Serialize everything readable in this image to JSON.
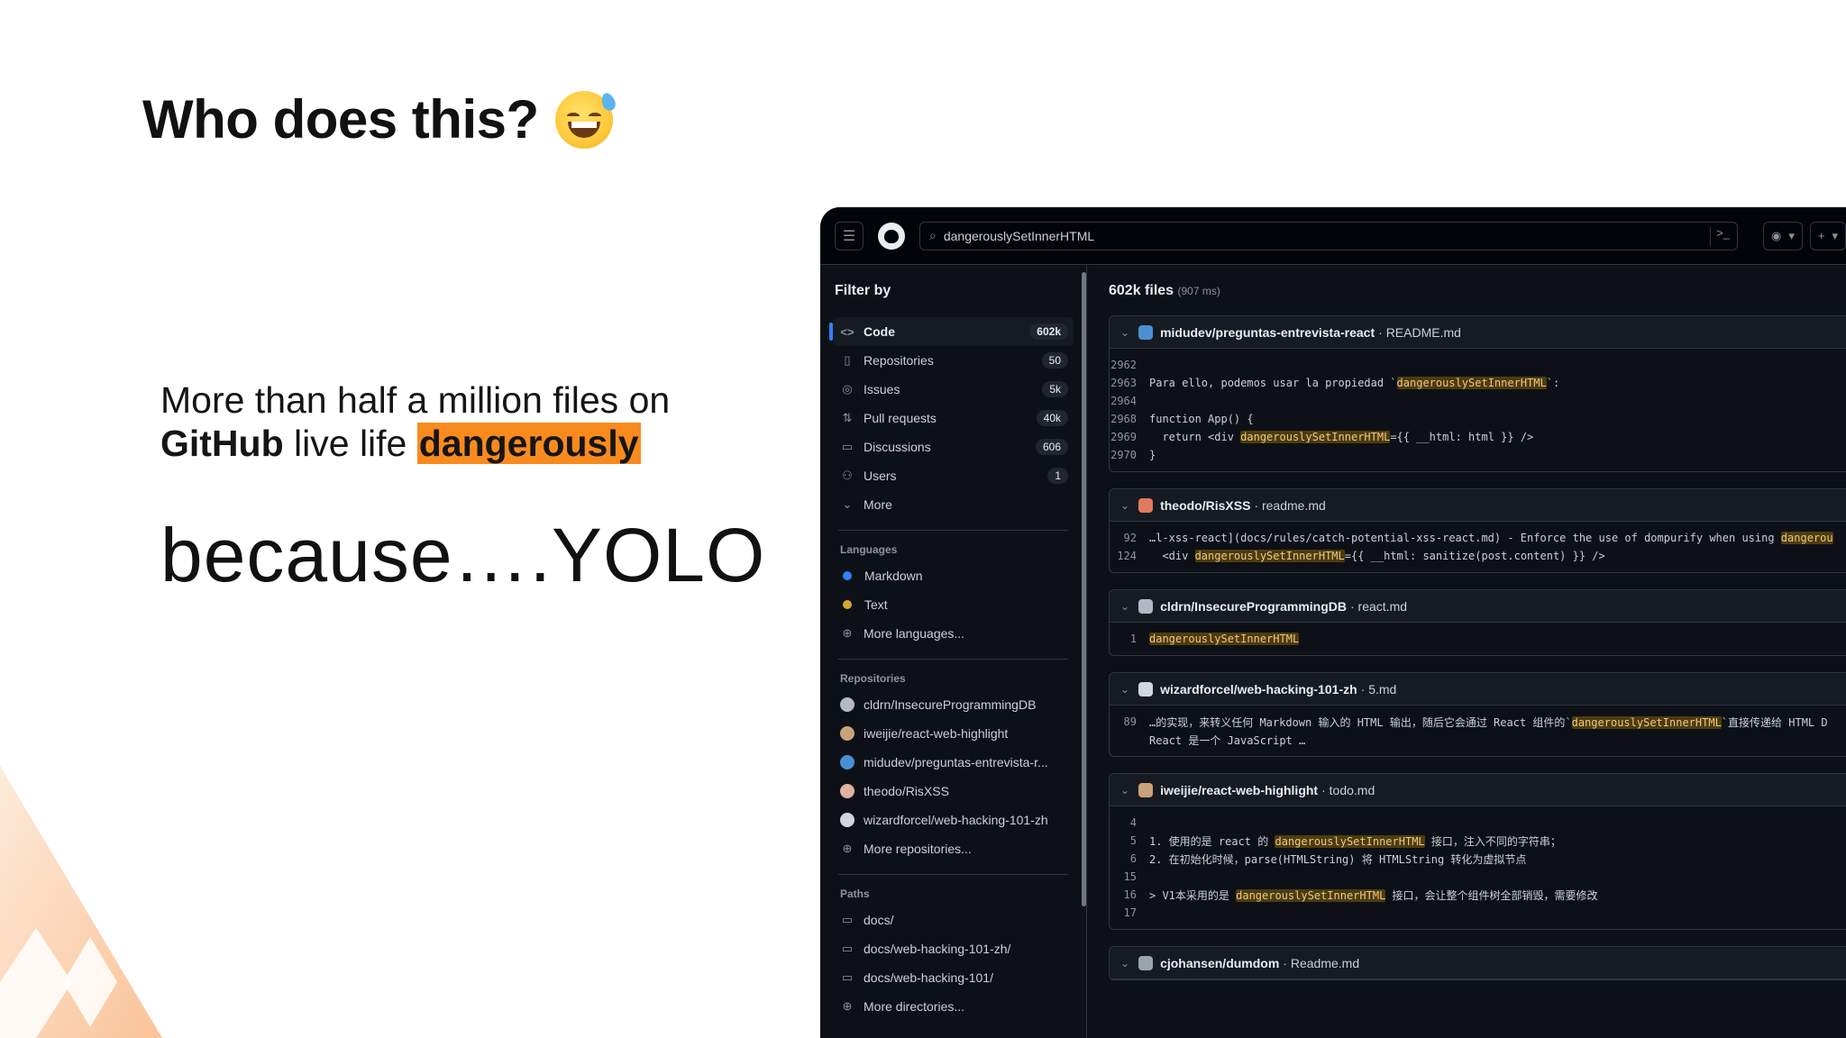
{
  "slide": {
    "title": "Who does this?",
    "subtitle_line1": "More than half a million files on",
    "subtitle_strong": "GitHub",
    "subtitle_mid": " live life ",
    "subtitle_highlight": "dangerously",
    "yolo": "because….YOLO",
    "emoji_icon": "grinning-sweat-emoji",
    "accent_color": "#f98a1e"
  },
  "github": {
    "search_value": "dangerouslySetInnerHTML",
    "filter_title": "Filter by",
    "nav": [
      {
        "label": "Code",
        "count": "602k",
        "icon": "code-icon"
      },
      {
        "label": "Repositories",
        "count": "50",
        "icon": "repo-icon"
      },
      {
        "label": "Issues",
        "count": "5k",
        "icon": "issue-icon"
      },
      {
        "label": "Pull requests",
        "count": "40k",
        "icon": "pull-request-icon"
      },
      {
        "label": "Discussions",
        "count": "606",
        "icon": "discussion-icon"
      },
      {
        "label": "Users",
        "count": "1",
        "icon": "user-icon"
      },
      {
        "label": "More",
        "icon": "chevron-down-icon"
      }
    ],
    "languages_label": "Languages",
    "languages": [
      {
        "label": "Markdown",
        "color": "#2f81f7"
      },
      {
        "label": "Text",
        "color": "#d4a72c"
      }
    ],
    "more_languages": "More languages...",
    "repos_label": "Repositories",
    "repos": [
      "cldrn/InsecureProgrammingDB",
      "iweijie/react-web-highlight",
      "midudev/preguntas-entrevista-r...",
      "theodo/RisXSS",
      "wizardforcel/web-hacking-101-zh"
    ],
    "more_repos": "More repositories...",
    "paths_label": "Paths",
    "paths": [
      "docs/",
      "docs/web-hacking-101-zh/",
      "docs/web-hacking-101/"
    ],
    "more_dirs": "More directories...",
    "result_count": "602k files",
    "result_ms": "(907 ms)",
    "cards": [
      {
        "repo": "midudev/preguntas-entrevista-react",
        "file": " · README.md",
        "lines": [
          {
            "n": "2962",
            "pre": "",
            "mark": "",
            "post": ""
          },
          {
            "n": "2963",
            "pre": "Para ello, podemos usar la propiedad `",
            "mark": "dangerouslySetInnerHTML",
            "post": "`:"
          },
          {
            "n": "2964",
            "pre": "",
            "mark": "",
            "post": ""
          },
          {
            "n": "2968",
            "pre": "function App() {",
            "mark": "",
            "post": ""
          },
          {
            "n": "2969",
            "pre": "  return <div ",
            "mark": "dangerouslySetInnerHTML",
            "post": "={{ __html: html }} />"
          },
          {
            "n": "2970",
            "pre": "}",
            "mark": "",
            "post": ""
          }
        ]
      },
      {
        "repo": "theodo/RisXSS",
        "file": " · readme.md",
        "lines": [
          {
            "n": "92",
            "pre": "…l-xss-react](docs/rules/catch-potential-xss-react.md) - Enforce the use of dompurify when using ",
            "mark": "dangerou",
            "post": ""
          },
          {
            "n": "124",
            "pre": "  <div ",
            "mark": "dangerouslySetInnerHTML",
            "post": "={{ __html: sanitize(post.content) }} />"
          }
        ]
      },
      {
        "repo": "cldrn/InsecureProgrammingDB",
        "file": " · react.md",
        "lines": [
          {
            "n": "1",
            "pre": "",
            "mark": "dangerouslySetInnerHTML",
            "post": ""
          }
        ]
      },
      {
        "repo": "wizardforcel/web-hacking-101-zh",
        "file": " · 5.md",
        "lines": [
          {
            "n": "89",
            "pre": "…的实现，来转义任何 Markdown 输入的 HTML 输出，随后它会通过 React 组件的`",
            "mark": "dangerouslySetInnerHTML",
            "post": "`直接传递给 HTML D"
          },
          {
            "n": "",
            "pre": "React 是一个 JavaScript …",
            "mark": "",
            "post": ""
          }
        ]
      },
      {
        "repo": "iweijie/react-web-highlight",
        "file": " · todo.md",
        "lines": [
          {
            "n": "4",
            "pre": "",
            "mark": "",
            "post": ""
          },
          {
            "n": "5",
            "pre": "1. 使用的是 react 的 ",
            "mark": "dangerouslySetInnerHTML",
            "post": " 接口，注入不同的字符串；"
          },
          {
            "n": "6",
            "pre": "2. 在初始化时候，parse(HTMLString) 将 HTMLString 转化为虚拟节点",
            "mark": "",
            "post": ""
          },
          {
            "n": "15",
            "pre": "",
            "mark": "",
            "post": ""
          },
          {
            "n": "16",
            "pre": "> V1本采用的是 ",
            "mark": "dangerouslySetInnerHTML",
            "post": " 接口，会让整个组件树全部销毁，需要修改"
          },
          {
            "n": "17",
            "pre": "",
            "mark": "",
            "post": ""
          }
        ]
      },
      {
        "repo": "cjohansen/dumdom",
        "file": " · Readme.md",
        "lines": []
      }
    ]
  }
}
